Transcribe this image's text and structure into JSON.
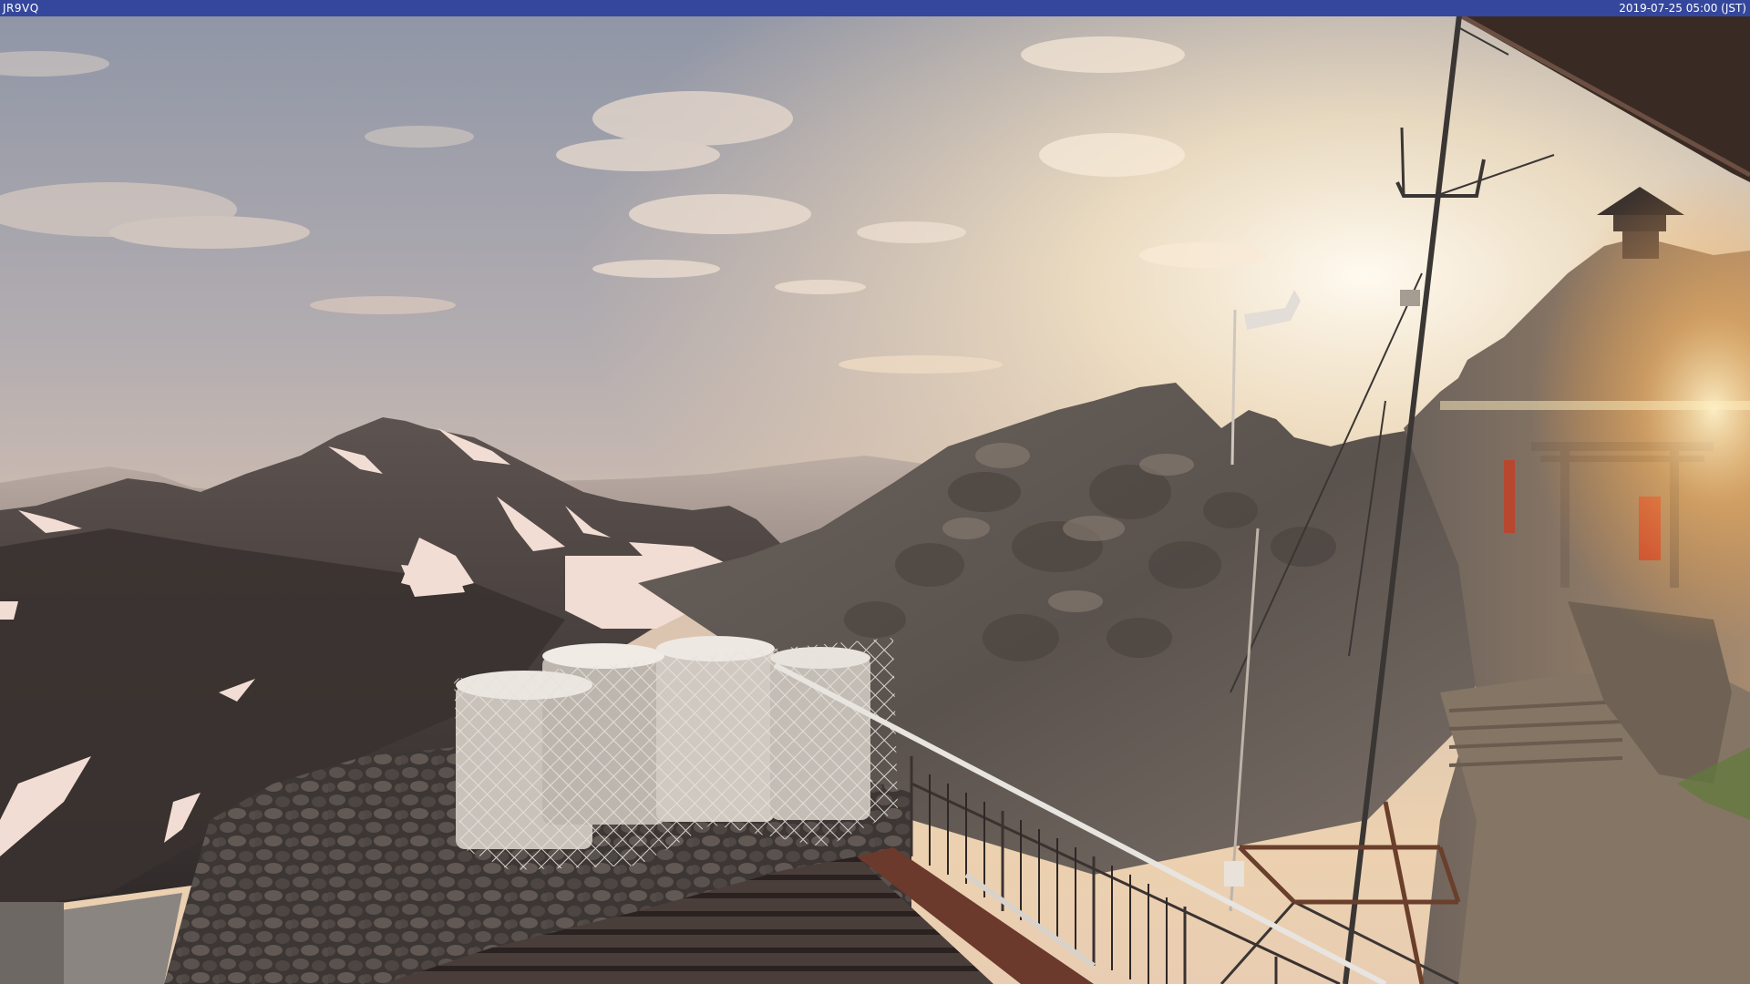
{
  "header": {
    "station_id": "JR9VQ",
    "timestamp": "2019-07-25 05:00 (JST)"
  },
  "colors": {
    "bar": "#34479c",
    "sky_top": "#8f97a8",
    "sky_horizon": "#e7c8a5",
    "sun_glow": "#fff4dc",
    "rock": "#6e655e",
    "snow": "#f1dcd4"
  }
}
